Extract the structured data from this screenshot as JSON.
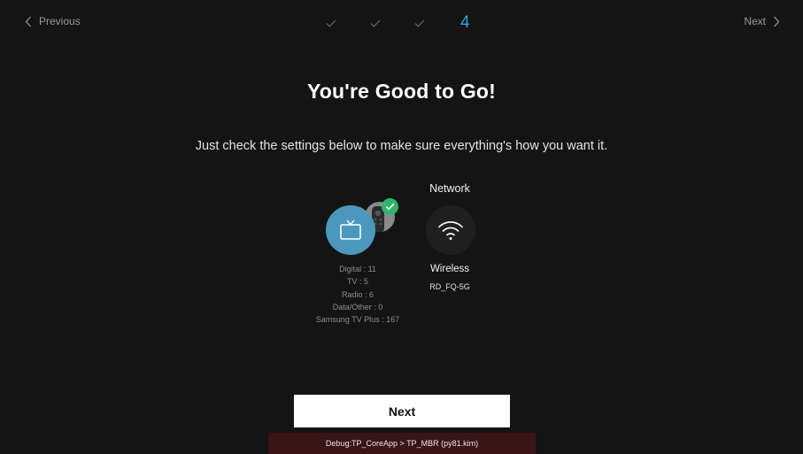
{
  "nav": {
    "previous_label": "Previous",
    "next_label": "Next"
  },
  "steps": {
    "completed_count": 3,
    "current": "4",
    "accent_color": "#2fa3e0"
  },
  "headline": "You're Good to Go!",
  "subtext": "Just check the settings below to make sure everything's how you want it.",
  "channels": {
    "icon": "tv-icon",
    "status_icon": "check-icon",
    "lines": [
      "Digital : 11",
      "TV : 5",
      "Radio : 6",
      "Data/Other : 0",
      "Samsung TV Plus : 167"
    ]
  },
  "network": {
    "title": "Network",
    "icon": "wifi-icon",
    "type": "Wireless",
    "ssid": "RD_FQ-5G"
  },
  "next_button_label": "Next",
  "debug_text": "Debug:TP_CoreApp > TP_MBR (py81.kim)"
}
